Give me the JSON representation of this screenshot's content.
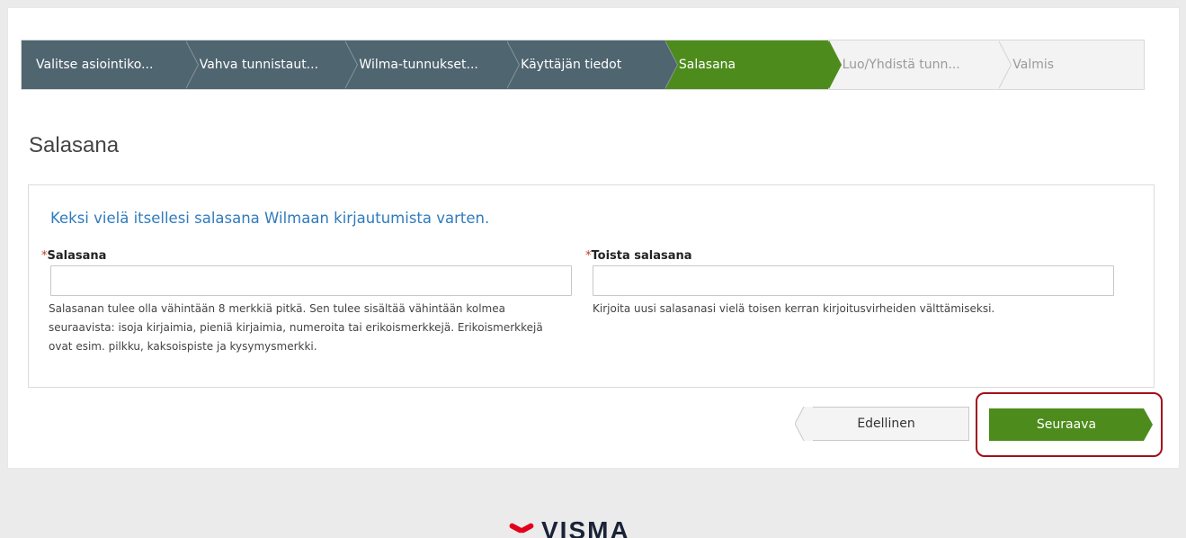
{
  "wizard": {
    "steps": [
      {
        "label": "Valitse asiointiko...",
        "state": "done"
      },
      {
        "label": "Vahva tunnistaut...",
        "state": "done"
      },
      {
        "label": "Wilma-tunnukset...",
        "state": "done"
      },
      {
        "label": "Käyttäjän tiedot",
        "state": "done"
      },
      {
        "label": "Salasana",
        "state": "active"
      },
      {
        "label": "Luo/Yhdistä tunn...",
        "state": "future"
      },
      {
        "label": "Valmis",
        "state": "future"
      }
    ]
  },
  "page": {
    "title": "Salasana",
    "lead": "Keksi vielä itsellesi salasana Wilmaan kirjautumista varten."
  },
  "form": {
    "required_mark": "*",
    "password": {
      "label": "Salasana",
      "value": "",
      "help_line1": "Salasanan tulee olla vähintään 8 merkkiä pitkä. Sen tulee sisältää vähintään kolmea",
      "help_line2": "seuraavista: isoja kirjaimia, pieniä kirjaimia, numeroita tai erikoismerkkejä. Erikoismerkkejä",
      "help_line3": "ovat esim. pilkku, kaksoispiste ja kysymysmerkki."
    },
    "password_repeat": {
      "label": "Toista salasana",
      "value": "",
      "help": "Kirjoita uusi salasanasi vielä toisen kerran kirjoitusvirheiden välttämiseksi."
    }
  },
  "buttons": {
    "previous": "Edellinen",
    "next": "Seuraava"
  },
  "footer": {
    "logo_text": "VISMA"
  },
  "colors": {
    "step_done": "#4f6570",
    "step_active": "#4d8c1c",
    "lead_text": "#2f7bbd",
    "highlight": "#a30f1a",
    "logo_red": "#e3001b"
  }
}
